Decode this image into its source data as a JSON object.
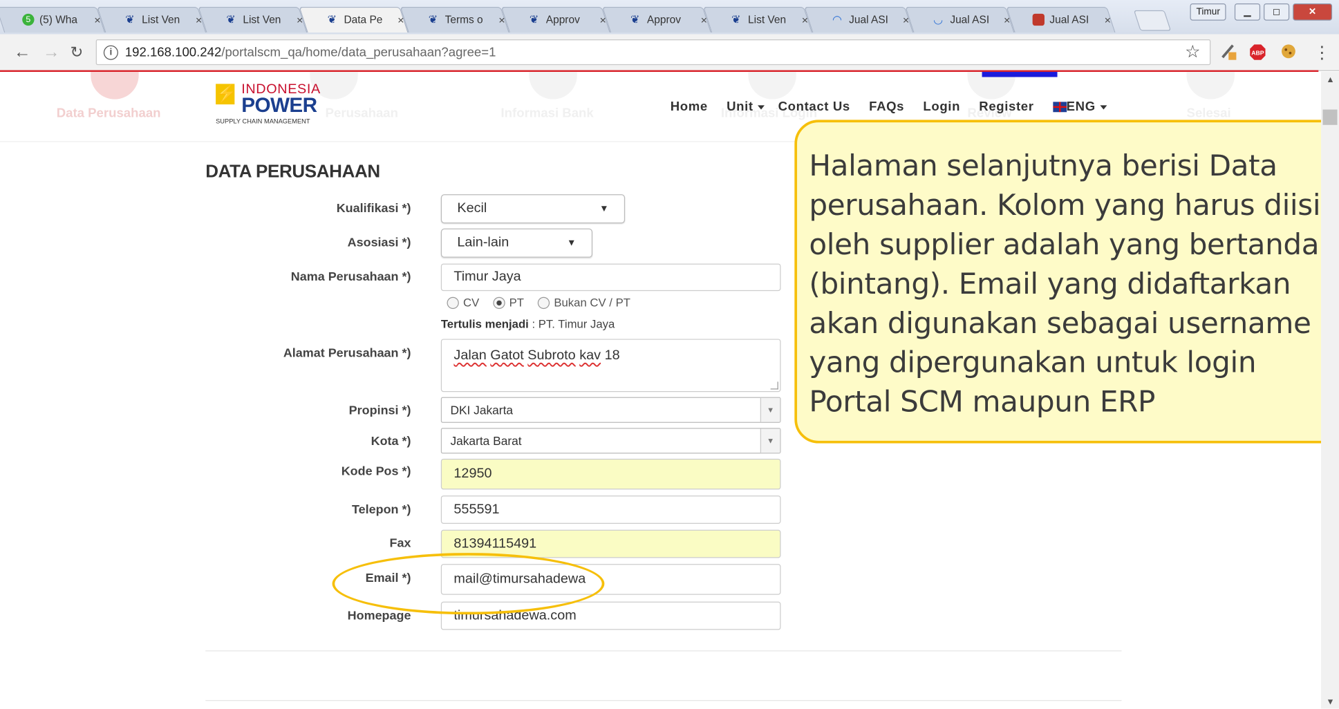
{
  "browser": {
    "tabs": [
      {
        "icon": "whatsapp-icon",
        "title": "(5) Wha"
      },
      {
        "icon": "flame-icon",
        "title": "List Ven"
      },
      {
        "icon": "flame-icon",
        "title": "List Ven"
      },
      {
        "icon": "flame-icon",
        "title": "Data Pe"
      },
      {
        "icon": "flame-icon",
        "title": "Terms o"
      },
      {
        "icon": "flame-icon",
        "title": "Approv"
      },
      {
        "icon": "flame-icon",
        "title": "Approv"
      },
      {
        "icon": "flame-icon",
        "title": "List Ven"
      },
      {
        "icon": "loading-icon",
        "title": "Jual ASI"
      },
      {
        "icon": "loading-icon",
        "title": "Jual ASI"
      },
      {
        "icon": "shop-icon",
        "title": "Jual ASI"
      }
    ],
    "tab_close": "×",
    "profile": "Timur",
    "url_host": "192.168.100.242",
    "url_path": "/portalscm_qa/home/data_perusahaan?agree=1"
  },
  "stepper": [
    "Data Perusahaan",
    "Perusahaan",
    "Informasi Bank",
    "Informasi Login",
    "Review",
    "Selesai"
  ],
  "logo": {
    "line1": "INDONESIA",
    "line2": "POWER",
    "line3": "SUPPLY CHAIN MANAGEMENT"
  },
  "menu": {
    "home": "Home",
    "unit": "Unit",
    "contact": "Contact Us",
    "faqs": "FAQs",
    "login": "Login",
    "register": "Register",
    "lang": "ENG"
  },
  "form": {
    "title": "DATA PERUSAHAAN",
    "kualifikasi_label": "Kualifikasi *)",
    "kualifikasi_value": "Kecil",
    "asosiasi_label": "Asosiasi *)",
    "asosiasi_value": "Lain-lain",
    "nama_label": "Nama Perusahaan *)",
    "nama_value": "Timur Jaya",
    "radio_cv": "CV",
    "radio_pt": "PT",
    "radio_bukan": "Bukan CV / PT",
    "tertulis_label": "Tertulis menjadi",
    "tertulis_value": ": PT. Timur Jaya",
    "alamat_label": "Alamat Perusahaan *)",
    "alamat_w1": "Jalan",
    "alamat_w2": "Gatot",
    "alamat_w3": "Subroto",
    "alamat_w4": "kav",
    "alamat_w5": "18",
    "propinsi_label": "Propinsi *)",
    "propinsi_value": "DKI Jakarta",
    "kota_label": "Kota *)",
    "kota_value": "Jakarta Barat",
    "kodepos_label": "Kode Pos *)",
    "kodepos_value": "12950",
    "telepon_label": "Telepon *)",
    "telepon_value": "555591",
    "fax_label": "Fax",
    "fax_value": "81394115491",
    "email_label": "Email *)",
    "email_value": "mail@timursahadewa",
    "homepage_label": "Homepage",
    "homepage_value": "timursahadewa.com"
  },
  "callout": "Halaman selanjutnya berisi Data perusahaan. Kolom yang harus diisi oleh supplier adalah yang bertanda * (bintang). Email yang didaftarkan akan digunakan sebagai username yang dipergunakan untuk login Portal SCM maupun ERP",
  "colors": {
    "accent": "#f6bf0a",
    "callout_bg": "#fefbc8",
    "brand_red": "#c8102e",
    "brand_blue": "#1b3f8f",
    "highlight_input": "#fafcc4"
  }
}
